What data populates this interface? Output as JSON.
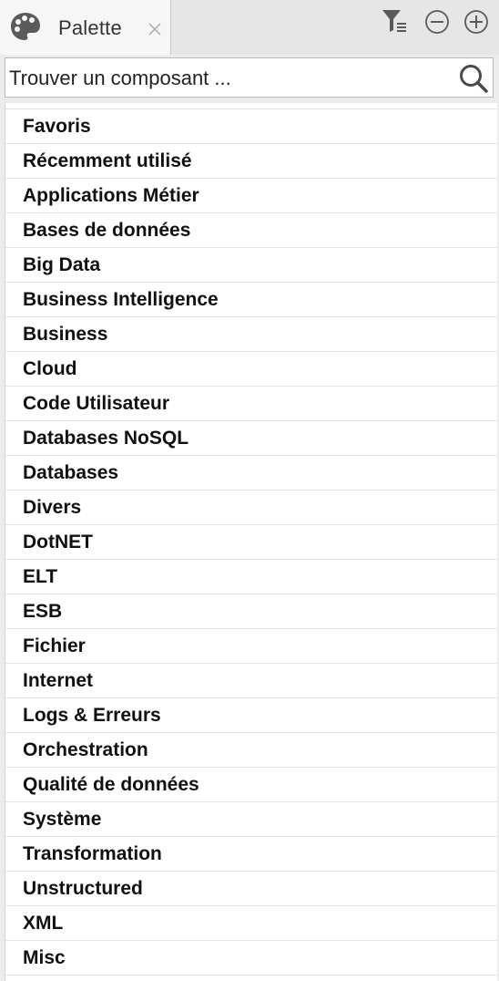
{
  "tab": {
    "icon": "palette-icon",
    "label": "Palette",
    "close_icon": "close-icon"
  },
  "toolbar": {
    "filter_icon": "filter-settings-icon",
    "collapse_icon": "minus-circle-icon",
    "expand_icon": "plus-circle-icon"
  },
  "search": {
    "placeholder": "Trouver un composant ...",
    "value": "",
    "icon": "search-icon"
  },
  "categories": [
    "Favoris",
    "Récemment utilisé",
    "Applications Métier",
    "Bases de données",
    "Big Data",
    "Business Intelligence",
    "Business",
    "Cloud",
    "Code Utilisateur",
    "Databases NoSQL",
    "Databases",
    "Divers",
    "DotNET",
    "ELT",
    "ESB",
    "Fichier",
    "Internet",
    "Logs & Erreurs",
    "Orchestration",
    "Qualité de données",
    "Système",
    "Transformation",
    "Unstructured",
    "XML",
    "Misc"
  ]
}
